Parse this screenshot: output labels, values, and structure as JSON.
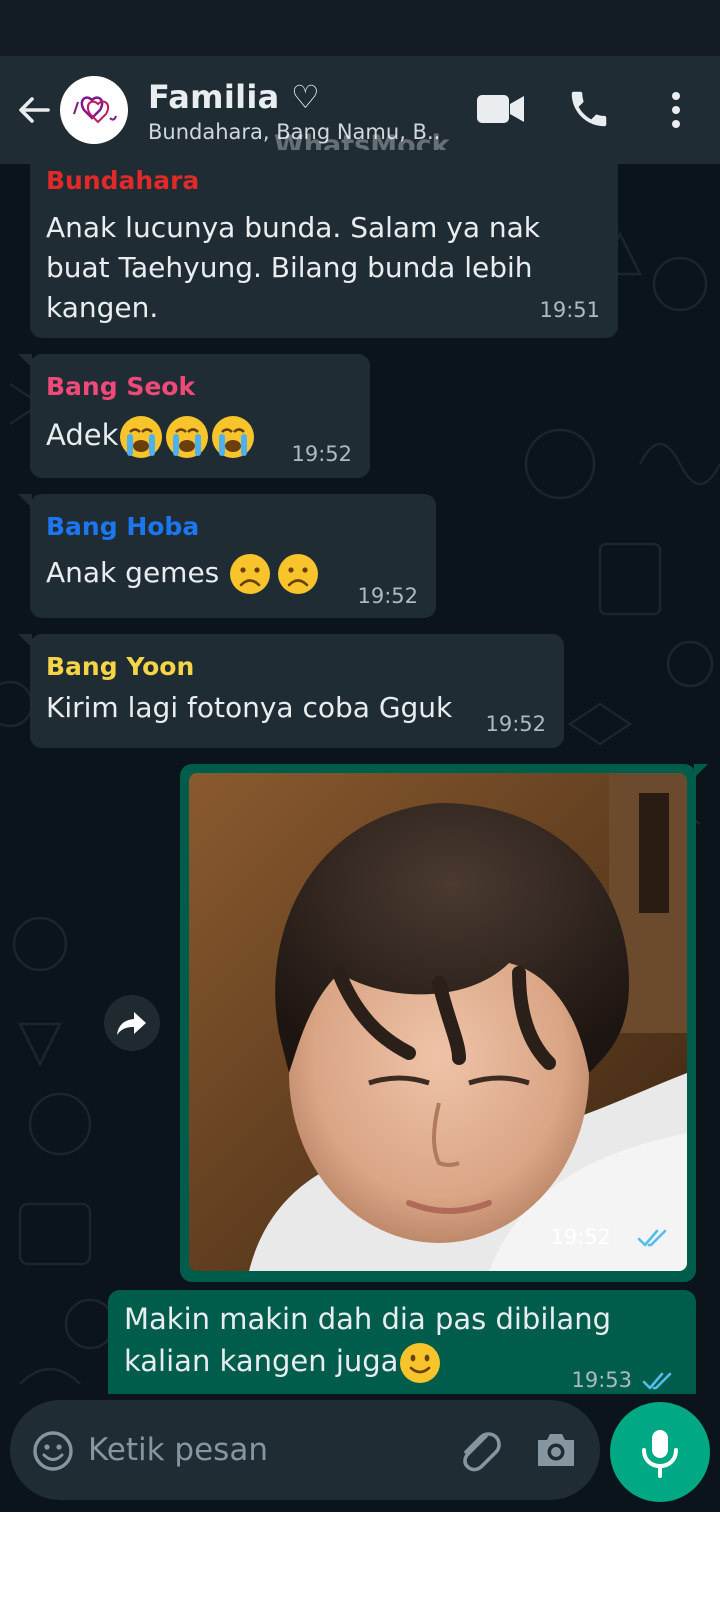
{
  "header": {
    "title": "Familia ♡",
    "subtitle": "Bundahara, Bang Namu, B..",
    "watermark": "WhatsMock"
  },
  "messages": [
    {
      "sender": "Bundahara",
      "sender_color": "#e02a2a",
      "lines": [
        "Anak lucunya bunda. Salam ya nak",
        "buat Taehyung. Bilang bunda lebih",
        "kangen."
      ],
      "time": "19:51"
    },
    {
      "sender": "Bang Seok",
      "sender_color": "#ef4979",
      "text": "Adek",
      "emojis": [
        "loudly-crying-face",
        "loudly-crying-face",
        "loudly-crying-face"
      ],
      "time": "19:52"
    },
    {
      "sender": "Bang Hoba",
      "sender_color": "#1c76f0",
      "text": "Anak gemes ",
      "emojis": [
        "frowning-face",
        "frowning-face"
      ],
      "time": "19:52"
    },
    {
      "sender": "Bang Yoon",
      "sender_color": "#f5d547",
      "text": "Kirim lagi fotonya coba Gguk",
      "time": "19:52"
    }
  ],
  "image_message": {
    "time": "19:52",
    "status": "read"
  },
  "outgoing": {
    "lines": [
      "Makin makin dah dia pas dibilang",
      "kalian kangen juga"
    ],
    "emoji": "slightly-smiling-face",
    "time": "19:53",
    "status": "read"
  },
  "input": {
    "placeholder": "Ketik pesan"
  },
  "colors": {
    "header_bg": "#1f2c34",
    "chat_bg": "#0b141a",
    "incoming_bubble": "#202c33",
    "outgoing_bubble": "#005c4b",
    "accent": "#00a884",
    "read_tick": "#53bdeb"
  },
  "icons": {
    "back": "arrow-left-icon",
    "video": "video-camera-icon",
    "call": "phone-icon",
    "menu": "more-vertical-icon",
    "forward": "forward-arrow-icon",
    "emoji": "emoji-icon",
    "attach": "paperclip-icon",
    "camera": "camera-icon",
    "mic": "microphone-icon"
  }
}
